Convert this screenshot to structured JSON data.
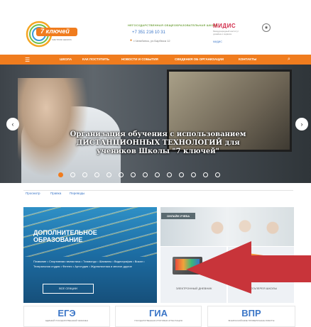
{
  "header": {
    "logo_text": "7 ключей",
    "logo_sub": "частная школа",
    "tagline": "НЕГОСУДАРСТВЕННАЯ ОБЩЕОБРАЗОВАТЕЛЬНАЯ ШКОЛА",
    "phone": "+7 351 216 10 31",
    "address": "г.Челябинск, ул.Барбюса 12",
    "partner": "МИДИС",
    "partner_desc": "Международный институт дизайна и сервиса",
    "partner_link": "МИДИС"
  },
  "nav": {
    "items": [
      "ШКОЛА",
      "КАК ПОСТУПИТЬ",
      "НОВОСТИ И СОБЫТИЯ",
      "СВЕДЕНИЯ ОБ ОРГАНИЗАЦИИ",
      "КОНТАКТЫ"
    ]
  },
  "slider": {
    "caption": "Организация обучения с использованием ДИСТАНЦИОННЫХ ТЕХНОЛОГИЙ для учеников Школы \"7 ключей\"",
    "prev": "‹",
    "next": "›",
    "dots_total": 14,
    "active_dot": 1
  },
  "tabs": [
    "Просмотр",
    "Правка",
    "Переводы"
  ],
  "cards": {
    "dop": {
      "title": "ДОПОЛНИТЕЛЬНОЕ ОБРАЗОВАНИЕ",
      "desc": "Плавание • Спортивная гимнастика • Тхэквондо • Шахматы • Видеография • Вокал • Театральная студия • Фитнес • Артстудия • Журналистика и многое другое",
      "button": "ВСЕ СЕКЦИИ"
    },
    "online": {
      "label": "ОНЛАЙН УЧЕБА"
    },
    "diary": {
      "label": "ЭЛЕКТРОННЫЙ ДНЕВНИК"
    },
    "gallery": {
      "label": "ФОТОГАЛЕРЕЯ ШКОЛЫ"
    }
  },
  "exams": [
    {
      "title": "ЕГЭ",
      "sub": "ЕДИНЫЙ ГОСУДАРСТВЕННЫЙ ЭКЗАМЕН"
    },
    {
      "title": "ГИА",
      "sub": "ГОСУДАРСТВЕННАЯ ИТОГОВАЯ АТТЕСТАЦИЯ"
    },
    {
      "title": "ВПР",
      "sub": "ВСЕРОССИЙСКИЕ ПРОВЕРОЧНЫЕ РАБОТЫ"
    }
  ],
  "colors": {
    "accent": "#f07c1e",
    "link": "#3b76c7",
    "arrow": "#c8343a"
  }
}
